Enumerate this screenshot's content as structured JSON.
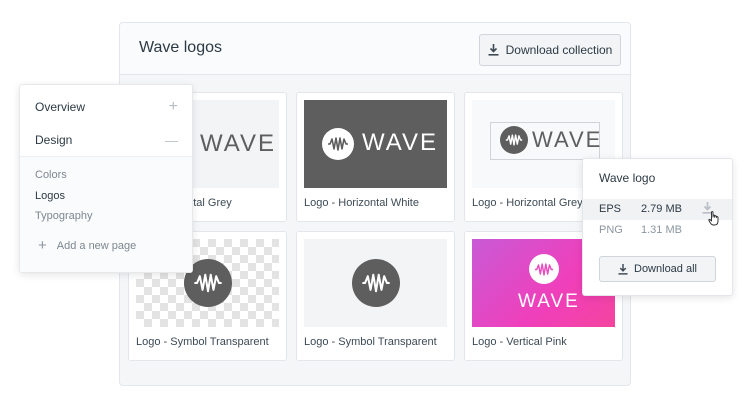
{
  "main": {
    "title": "Wave logos",
    "download_collection_label": "Download collection",
    "cards": [
      {
        "caption": "Logo - Horizontal Grey",
        "visible_caption": "ontal Grey",
        "wordmark": "WAVE"
      },
      {
        "caption": "Logo - Horizontal White",
        "wordmark": "WAVE"
      },
      {
        "caption": "Logo - Horizontal Grey S",
        "wordmark": "WAVE"
      },
      {
        "caption": "Logo - Symbol Transparent"
      },
      {
        "caption": "Logo - Symbol Transparent"
      },
      {
        "caption": "Logo - Vertical Pink",
        "wordmark": "WAVE"
      }
    ]
  },
  "sidebar": {
    "sections": [
      {
        "label": "Overview",
        "sign": "+"
      },
      {
        "label": "Design",
        "sign": "—"
      }
    ],
    "links": [
      {
        "label": "Colors"
      },
      {
        "label": "Logos"
      },
      {
        "label": "Typography"
      }
    ],
    "add_page_label": "Add a new page",
    "add_page_sign": "+"
  },
  "popover": {
    "title": "Wave logo",
    "files": [
      {
        "format": "EPS",
        "size": "2.79 MB"
      },
      {
        "format": "PNG",
        "size": "1.31 MB"
      }
    ],
    "download_all_label": "Download all"
  },
  "colors": {
    "logo_dark": "#5e5e5e",
    "pink_gradient_start": "#c95ad6",
    "pink_gradient_end": "#f4449e"
  },
  "icons": [
    "download-icon",
    "plus-icon",
    "minus-icon",
    "wave-symbol-icon",
    "hand-cursor-icon"
  ]
}
